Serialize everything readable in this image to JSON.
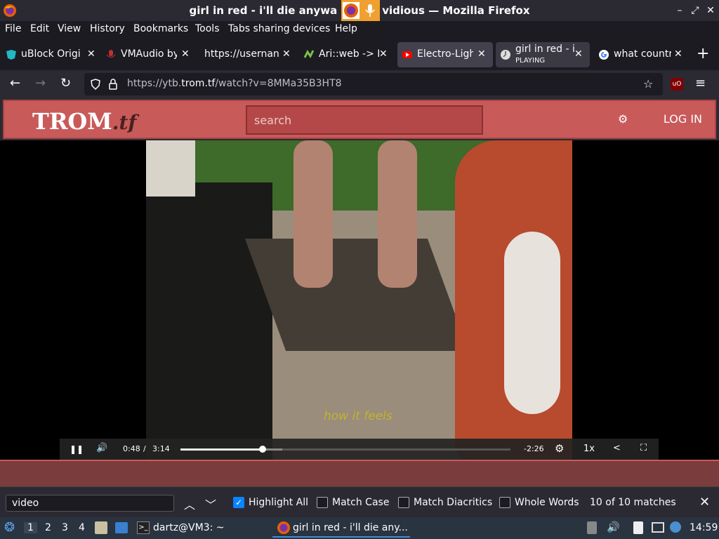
{
  "window": {
    "title": "girl in red - i'll die anyway - Invidious — Mozilla Firefox",
    "title_visible": "girl in red - i'll die anywa",
    "title_visible_tail": "vidious — Mozilla Firefox",
    "minimize": "–",
    "maximize": "⤢",
    "close": "✕"
  },
  "menubar": [
    {
      "label": "File"
    },
    {
      "label": "Edit"
    },
    {
      "label": "View"
    },
    {
      "label": "History"
    },
    {
      "label": "Bookmarks"
    },
    {
      "label": "Tools"
    },
    {
      "label": "Tabs sharing devices"
    },
    {
      "label": "Help"
    }
  ],
  "tabs": [
    {
      "label": "uBlock Origi",
      "icon": "ublock-icon"
    },
    {
      "label": "VMAudio by",
      "icon": "mic-icon"
    },
    {
      "label": "https://usernan",
      "icon": "blank"
    },
    {
      "label": "Ari::web -> I",
      "icon": "pixel-icon"
    },
    {
      "label": "Electro-Ligh",
      "icon": "youtube-icon"
    },
    {
      "label": "girl in red - i",
      "sub": "PLAYING",
      "icon": "invidious-icon"
    },
    {
      "label": "what countr",
      "icon": "google-icon"
    }
  ],
  "navbar": {
    "url_prefix": "https://ytb.",
    "url_domain": "trom.tf",
    "url_rest": "/watch?v=8MMa35B3HT8"
  },
  "site": {
    "logo_main": "TROM",
    "logo_tld": ".tf",
    "search_placeholder": "search",
    "login": "LOG IN",
    "gear": "⚙"
  },
  "video": {
    "caption": "how it feels",
    "current_time": "0:48",
    "separator": "/",
    "duration": "3:14",
    "remaining": "-2:26",
    "speed": "1x",
    "progress_fraction": 0.25
  },
  "findbar": {
    "query": "video",
    "highlight_all": "Highlight All",
    "match_case": "Match Case",
    "match_diacritics": "Match Diacritics",
    "whole_words": "Whole Words",
    "results": "10 of 10 matches",
    "highlight_all_checked": true
  },
  "taskbar": {
    "workspaces": [
      "1",
      "2",
      "3",
      "4"
    ],
    "terminal": "dartz@VM3: ~",
    "firefox_window": "girl in red - i'll die any...",
    "clock": "14:59"
  }
}
